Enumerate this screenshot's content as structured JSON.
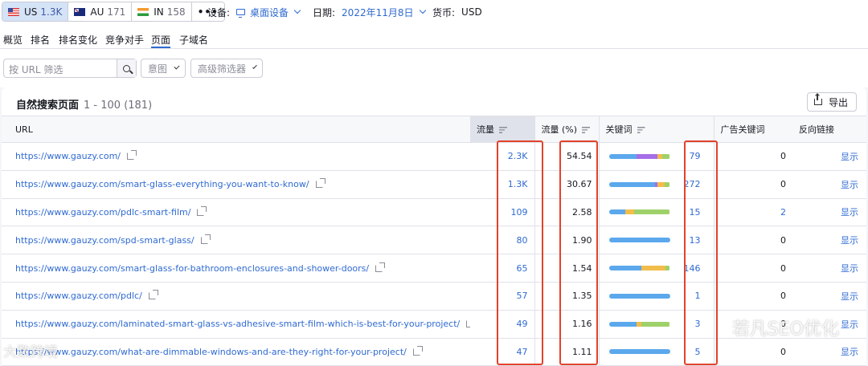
{
  "topbar": {
    "databases": [
      {
        "code": "US",
        "count": "1.3K",
        "flag": "flag-us-icon",
        "active": true
      },
      {
        "code": "AU",
        "count": "171",
        "flag": "flag-au-icon",
        "active": false
      },
      {
        "code": "IN",
        "count": "158",
        "flag": "flag-in-icon",
        "active": false
      }
    ],
    "more_label": "•••",
    "device_label": "设备:",
    "device_value": "桌面设备",
    "date_label": "日期:",
    "date_value": "2022年11月8日",
    "currency_label": "货币:",
    "currency_value": "USD"
  },
  "tabs": [
    "概览",
    "排名",
    "排名变化",
    "竞争对手",
    "页面",
    "子域名"
  ],
  "active_tab": "页面",
  "filters": {
    "search_placeholder": "按 URL 筛选",
    "intent_label": "意图",
    "advanced_label": "高级筛选器"
  },
  "card": {
    "title": "自然搜索页面",
    "count": "1 - 100 (181)",
    "export_label": "导出"
  },
  "table": {
    "headers": {
      "url": "URL",
      "traffic": "流量",
      "traffic_pct": "流量 (%)",
      "keywords": "关键词",
      "ads_keywords": "广告关键词",
      "backlinks": "反向链接"
    },
    "rows": [
      {
        "url": "https://www.gauzy.com/",
        "traffic": "2.3K",
        "pct": "54.54",
        "kw_bar": [
          0.45,
          0.35,
          0.08,
          0.12
        ],
        "keywords": "79",
        "ads": "0",
        "backlinks": "显示"
      },
      {
        "url": "https://www.gauzy.com/smart-glass-everything-you-want-to-know/",
        "traffic": "1.3K",
        "pct": "30.67",
        "kw_bar": [
          0.75,
          0.04,
          0.12,
          0.09
        ],
        "keywords": "272",
        "ads": "0",
        "backlinks": "显示"
      },
      {
        "url": "https://www.gauzy.com/pdlc-smart-film/",
        "traffic": "109",
        "pct": "2.58",
        "kw_bar": [
          0.27,
          0.0,
          0.15,
          0.58
        ],
        "keywords": "15",
        "ads": "2",
        "backlinks": "显示"
      },
      {
        "url": "https://www.gauzy.com/spd-smart-glass/",
        "traffic": "80",
        "pct": "1.90",
        "kw_bar": [
          1.0,
          0,
          0,
          0
        ],
        "keywords": "13",
        "ads": "0",
        "backlinks": "显示"
      },
      {
        "url": "https://www.gauzy.com/smart-glass-for-bathroom-enclosures-and-shower-doors/",
        "traffic": "65",
        "pct": "1.54",
        "kw_bar": [
          0.53,
          0.0,
          0.4,
          0.07
        ],
        "keywords": "146",
        "ads": "0",
        "backlinks": "显示"
      },
      {
        "url": "https://www.gauzy.com/pdlc/",
        "traffic": "57",
        "pct": "1.35",
        "kw_bar": [
          1.0,
          0,
          0,
          0
        ],
        "keywords": "1",
        "ads": "0",
        "backlinks": "显示"
      },
      {
        "url": "https://www.gauzy.com/laminated-smart-glass-vs-adhesive-smart-film-which-is-best-for-your-project/",
        "traffic": "49",
        "pct": "1.16",
        "kw_bar": [
          0.45,
          0.0,
          0.08,
          0.47
        ],
        "keywords": "3",
        "ads": "0",
        "backlinks": "显示"
      },
      {
        "url": "https://www.gauzy.com/what-are-dimmable-windows-and-are-they-right-for-your-project/",
        "traffic": "47",
        "pct": "1.11",
        "kw_bar": [
          1.0,
          0,
          0,
          0
        ],
        "keywords": "5",
        "ads": "0",
        "backlinks": "显示"
      }
    ]
  },
  "kw_bar_colors": [
    "#5ba8ec",
    "#a66ee8",
    "#f2bd4a",
    "#9fd16a"
  ],
  "annotation_color": "#e2432c",
  "watermarks": {
    "right": "若凡SEO优化",
    "left": "大数跨境"
  }
}
